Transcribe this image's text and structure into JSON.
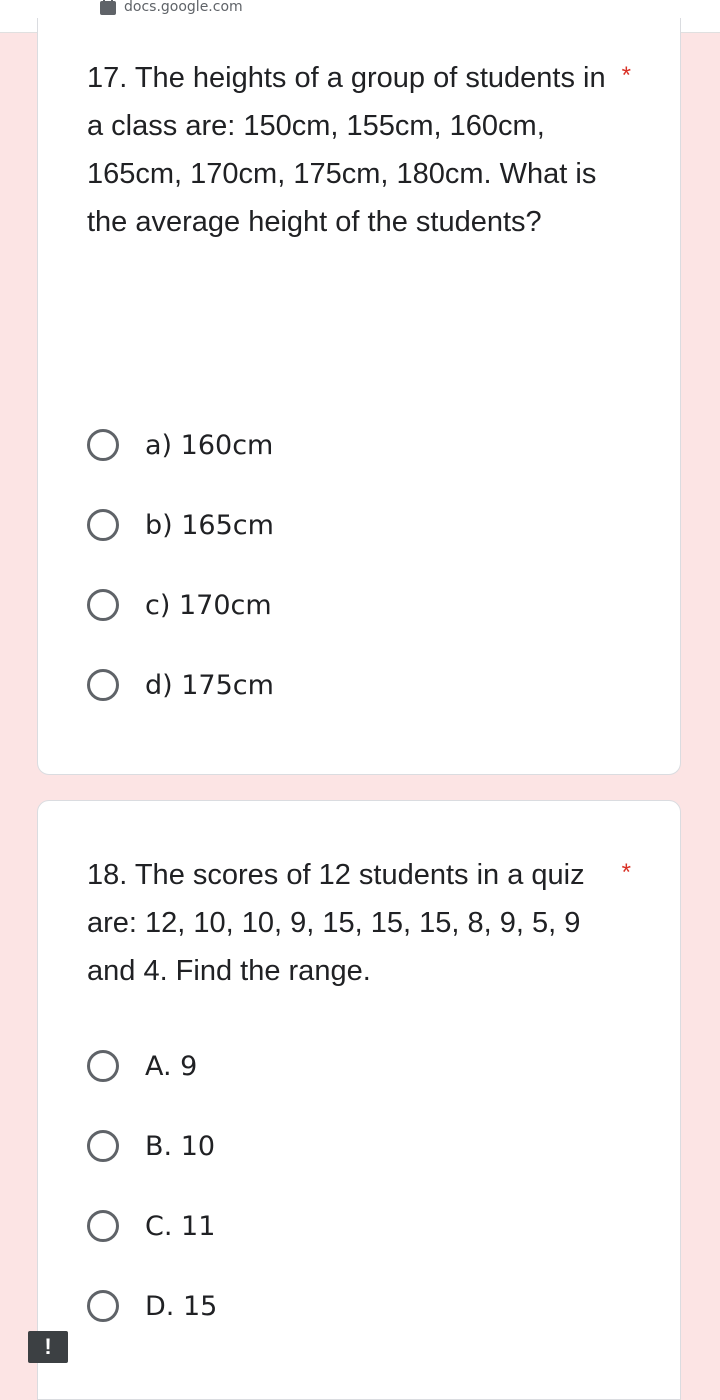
{
  "browser": {
    "url": "docs.google.com"
  },
  "questions": [
    {
      "text": "17.  The heights of a group of students in a class are: 150cm, 155cm, 160cm, 165cm, 170cm, 175cm, 180cm. What is the average height of the students?",
      "required_marker": "*",
      "options": [
        "a) 160cm",
        "b) 165cm",
        "c) 170cm",
        "d) 175cm"
      ]
    },
    {
      "text": "18. The scores of 12 students in a quiz are:   12, 10, 10, 9, 15, 15, 15, 8, 9, 5, 9 and 4. Find the range.",
      "required_marker": "*",
      "options": [
        "A. 9",
        "B. 10",
        "C. 11",
        "D. 15"
      ]
    }
  ],
  "feedback_button": {
    "label": "!"
  }
}
